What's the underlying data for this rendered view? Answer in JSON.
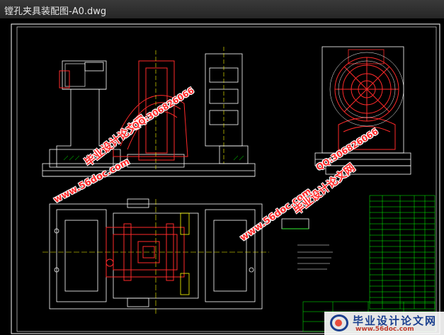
{
  "window": {
    "title": "镗孔夹具装配图-A0.dwg"
  },
  "watermarks": {
    "url_1": "www.56doc.com",
    "name_1": "毕业设计论文网",
    "qq_1": "QQ:306826066",
    "url_2": "www.56doc.com",
    "name_2": "毕业设计论文网",
    "qq_2": "QQ:306826066"
  },
  "logo": {
    "name": "毕业设计论文网",
    "url": "www.56doc.com"
  },
  "colors": {
    "background": "#000000",
    "frame": "#ffffff",
    "part_red": "#ff2a2a",
    "line_yellow": "#ffff00",
    "table_green": "#00ff00",
    "accent_cyan": "#00ffff"
  }
}
